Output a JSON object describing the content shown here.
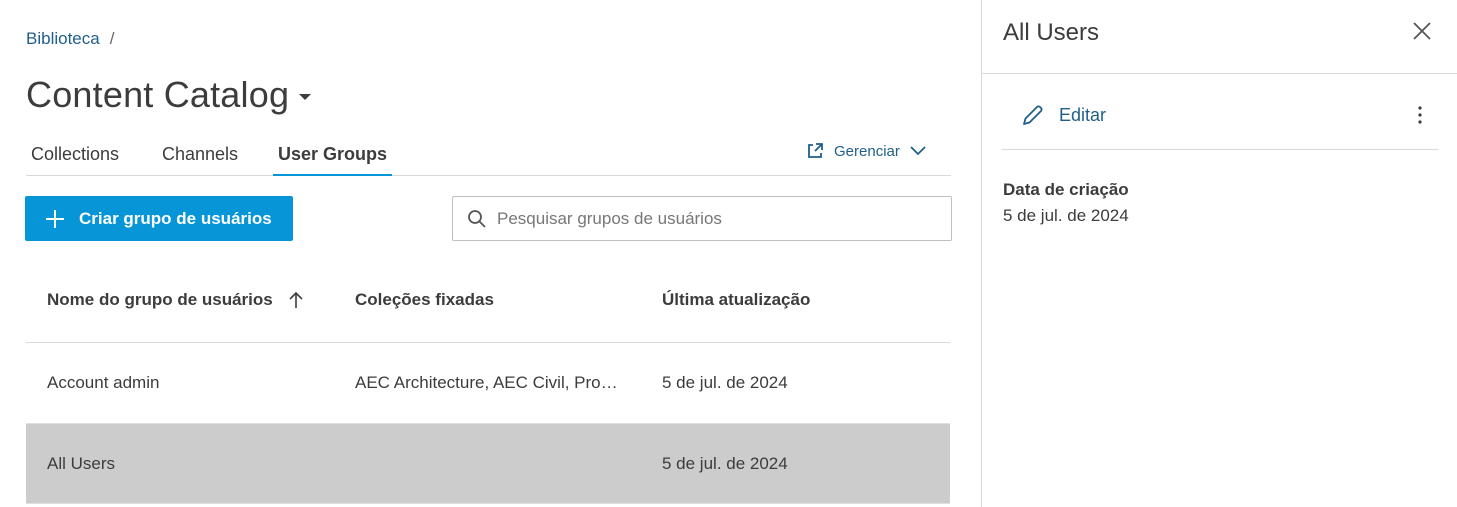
{
  "breadcrumb": {
    "link": "Biblioteca",
    "separator": "/"
  },
  "page": {
    "title": "Content Catalog"
  },
  "tabs": [
    {
      "label": "Collections"
    },
    {
      "label": "Channels"
    },
    {
      "label": "User Groups",
      "active": true
    }
  ],
  "manage": {
    "label": "Gerenciar",
    "icon": "external-link-icon"
  },
  "create_button": {
    "label": "Criar grupo de usuários",
    "icon": "plus-icon"
  },
  "search": {
    "placeholder": "Pesquisar grupos de usuários",
    "value": "",
    "icon": "search-icon"
  },
  "table": {
    "headers": [
      "Nome do grupo de usuários",
      "Coleções fixadas",
      "Última atualização"
    ],
    "sort": {
      "column": 0,
      "direction": "ascending",
      "icon": "arrow-up-icon"
    },
    "rows": [
      {
        "name": "Account admin",
        "collections": "AEC Architecture, AEC Civil, Product Design...",
        "updated": "5 de jul. de 2024"
      },
      {
        "name": "All Users",
        "collections": "",
        "updated": "5 de jul. de 2024",
        "selected": true
      }
    ]
  },
  "panel": {
    "title": "All Users",
    "edit_label": "Editar",
    "created_label": "Data de criação",
    "created_value": "5 de jul. de 2024"
  },
  "colors": {
    "accent": "#0696d7",
    "link": "#1f5f8b",
    "selected_row": "#cccccc",
    "text": "#3c3c3c"
  }
}
